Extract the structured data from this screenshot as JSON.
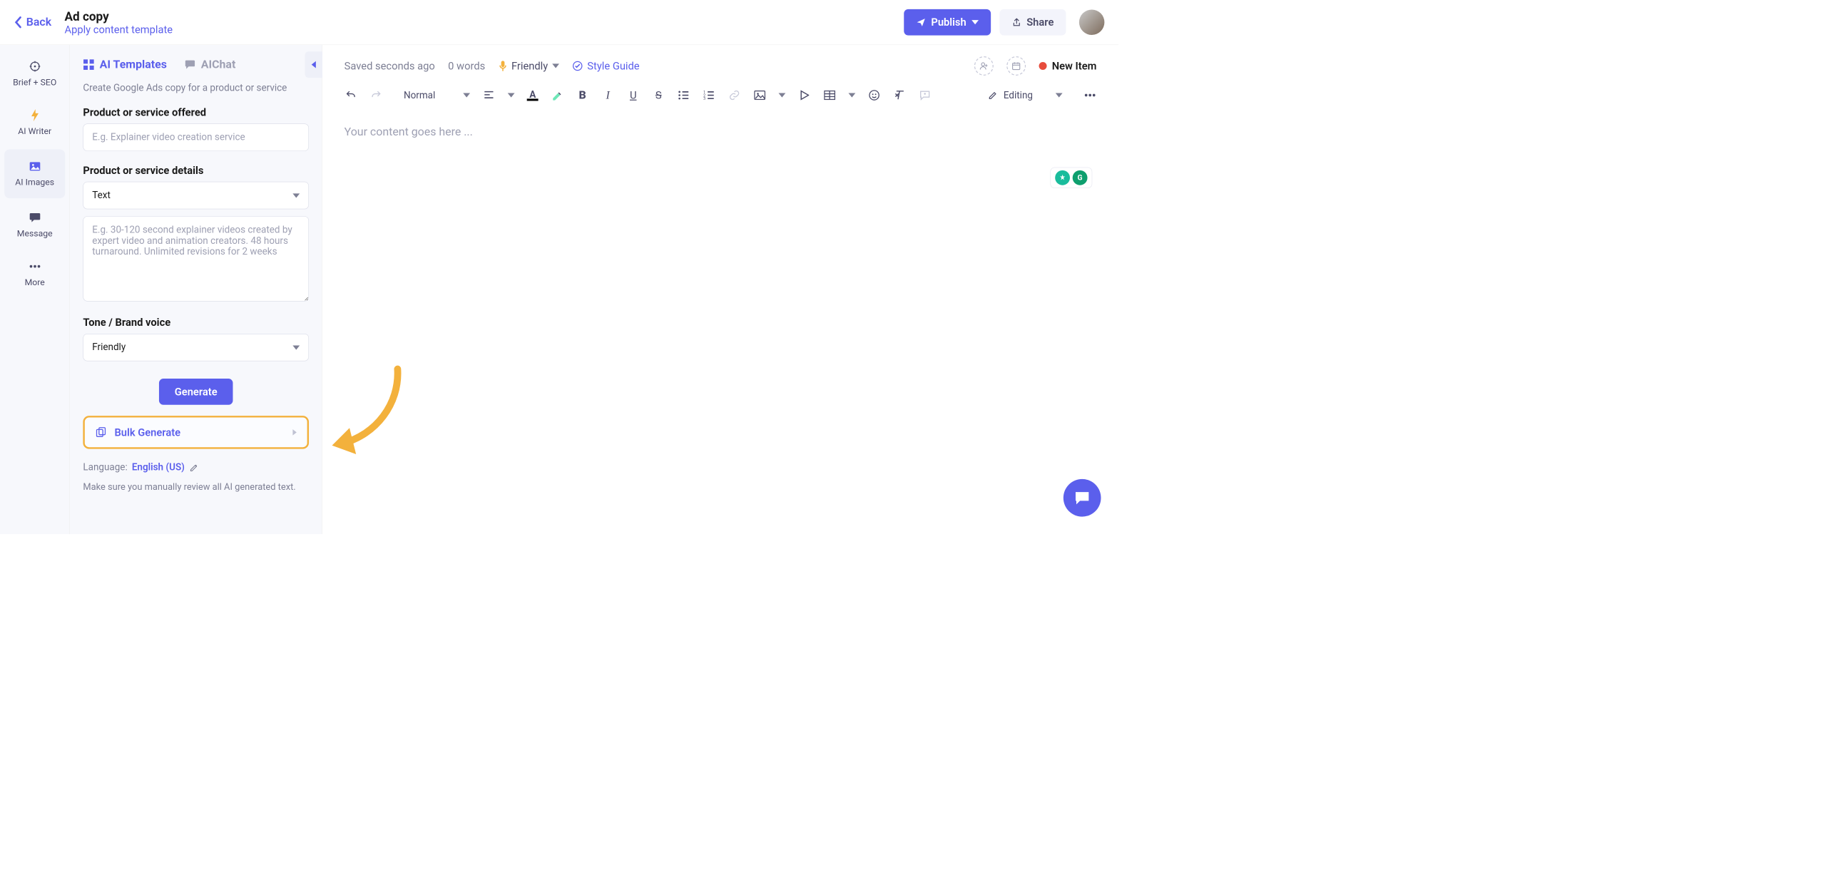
{
  "header": {
    "back": "Back",
    "title": "Ad copy",
    "apply_template": "Apply content template",
    "publish": "Publish",
    "share": "Share"
  },
  "rail": {
    "items": [
      {
        "label": "Brief + SEO"
      },
      {
        "label": "AI Writer"
      },
      {
        "label": "AI Images"
      },
      {
        "label": "Message"
      },
      {
        "label": "More"
      }
    ]
  },
  "panel": {
    "tabs": {
      "templates": "AI Templates",
      "chat": "AIChat"
    },
    "description": "Create Google Ads copy for a product or service",
    "product_label": "Product or service offered",
    "product_placeholder": "E.g. Explainer video creation service",
    "details_label": "Product or service details",
    "details_mode": "Text",
    "details_placeholder": "E.g. 30-120 second explainer videos created by expert video and animation creators. 48 hours turnaround. Unlimited revisions for 2 weeks",
    "tone_label": "Tone / Brand voice",
    "tone_value": "Friendly",
    "generate": "Generate",
    "bulk": "Bulk Generate",
    "language_label": "Language:",
    "language_value": "English (US)",
    "disclaimer": "Make sure you manually review all AI generated text."
  },
  "editor": {
    "saved": "Saved seconds ago",
    "words": "0 words",
    "tone": "Friendly",
    "style_guide": "Style Guide",
    "new_item": "New Item",
    "format": "Normal",
    "mode": "Editing",
    "placeholder": "Your content goes here ..."
  }
}
